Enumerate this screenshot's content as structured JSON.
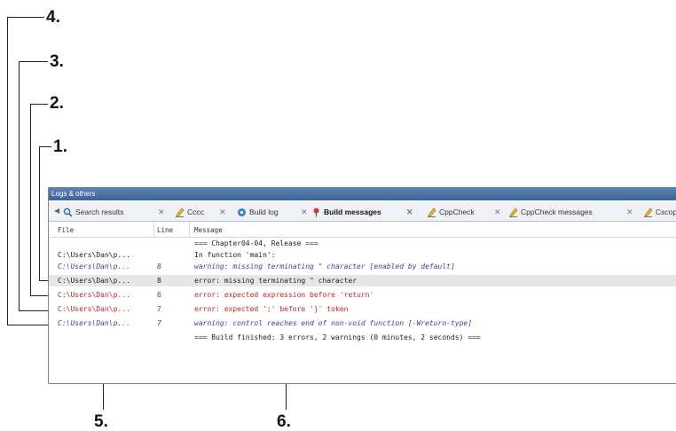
{
  "callouts": [
    "4.",
    "3.",
    "2.",
    "1.",
    "5.",
    "6."
  ],
  "panel": {
    "title": "Logs & others",
    "tabs": [
      {
        "label": "Search results",
        "icon": "search-icon",
        "active": false
      },
      {
        "label": "Cccc",
        "icon": "pencil-icon",
        "active": false
      },
      {
        "label": "Build log",
        "icon": "gear-icon",
        "active": false
      },
      {
        "label": "Build messages",
        "icon": "pin-icon",
        "active": true
      },
      {
        "label": "CppCheck",
        "icon": "pencil-icon",
        "active": false
      },
      {
        "label": "CppCheck messages",
        "icon": "pencil-icon",
        "active": false
      },
      {
        "label": "Cscop",
        "icon": "pencil-icon",
        "active": false
      }
    ],
    "columns": {
      "file": "File",
      "line": "Line",
      "message": "Message"
    },
    "rows": [
      {
        "file": "",
        "line": "",
        "message": "=== Chapter04-04, Release ===",
        "kind": "normal"
      },
      {
        "file": "C:\\Users\\Dan\\p...",
        "line": "",
        "message": "In function 'main':",
        "kind": "normal"
      },
      {
        "file": "C:\\Users\\Dan\\p...",
        "line": "8",
        "message": "warning: missing terminating \" character [enabled by default]",
        "kind": "warn"
      },
      {
        "file": "C:\\Users\\Dan\\p...",
        "line": "8",
        "message": "error: missing terminating \" character",
        "kind": "normal",
        "selected": true
      },
      {
        "file": "C:\\Users\\Dan\\p...",
        "line": "6",
        "message": "error: expected expression before 'return'",
        "kind": "err"
      },
      {
        "file": "C:\\Users\\Dan\\p...",
        "line": "7",
        "message": "error: expected ';' before '}' token",
        "kind": "err"
      },
      {
        "file": "C:\\Users\\Dan\\p...",
        "line": "7",
        "message": "warning: control reaches end of non-void function [-Wreturn-type]",
        "kind": "warn"
      },
      {
        "file": "",
        "line": "",
        "message": "=== Build finished: 3 errors, 2 warnings (0 minutes, 2 seconds) ===",
        "kind": "normal"
      }
    ]
  }
}
